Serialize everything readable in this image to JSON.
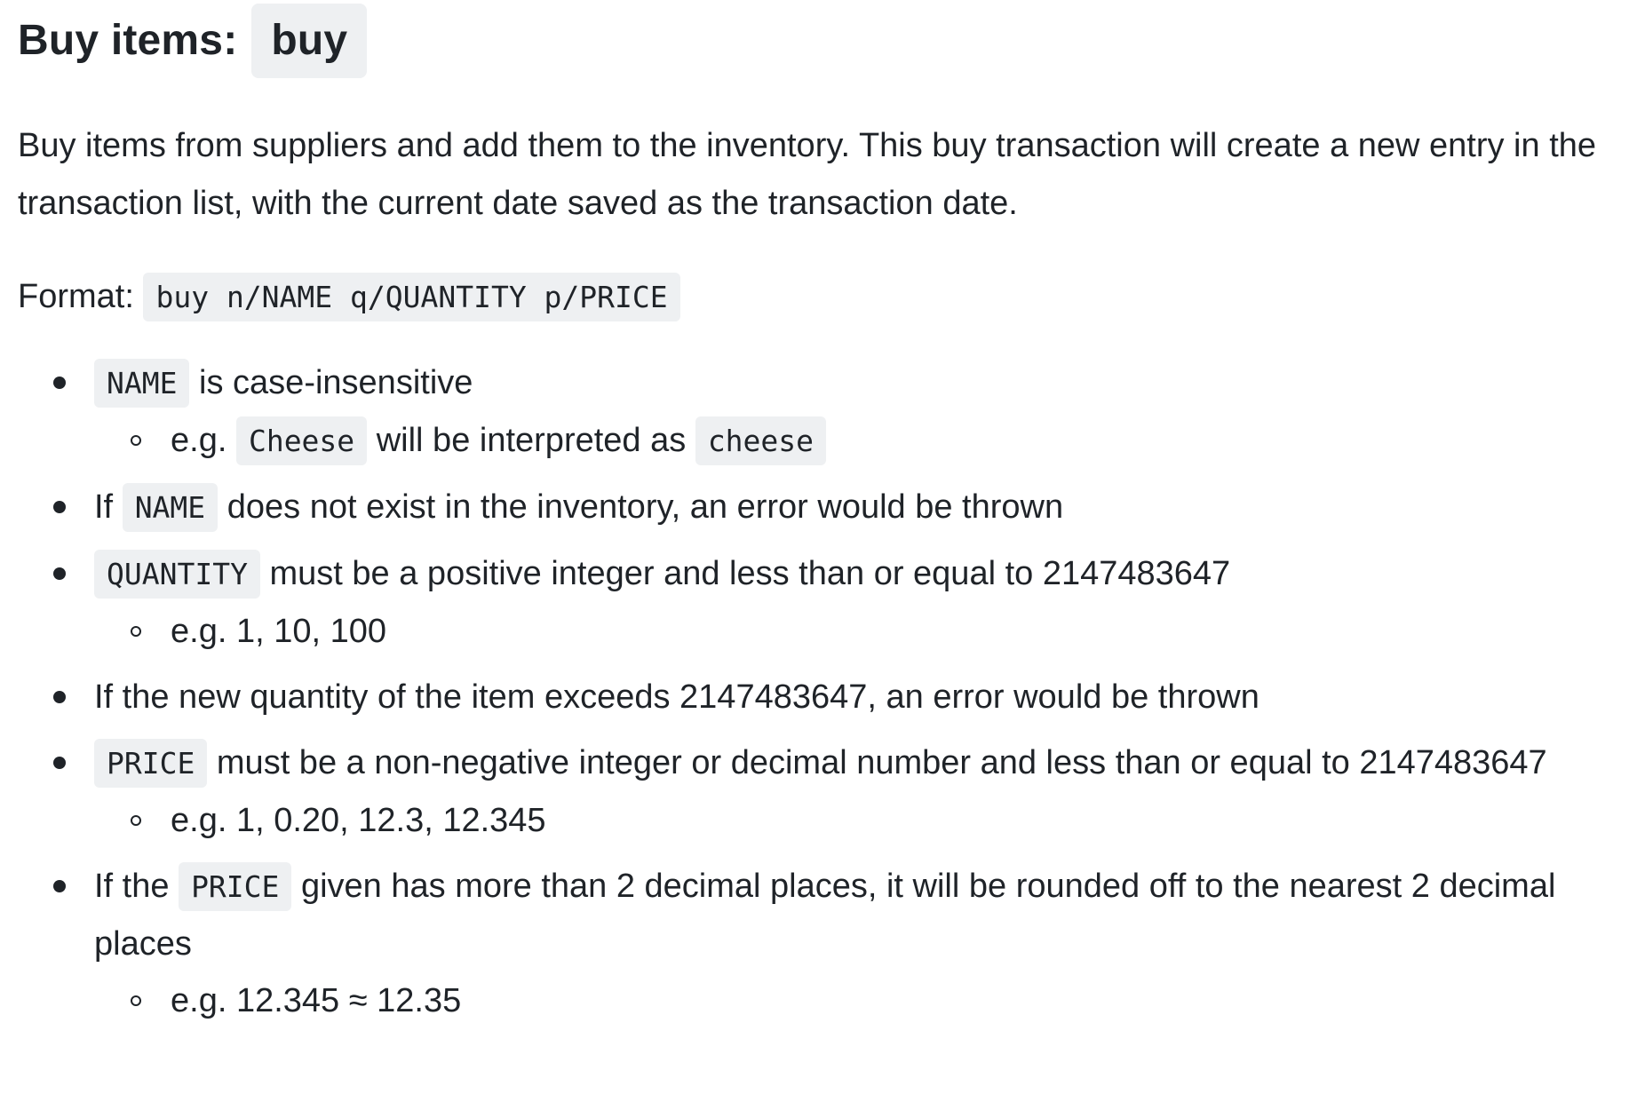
{
  "heading": {
    "text": "Buy items:",
    "command": "buy"
  },
  "description": "Buy items from suppliers and add them to the inventory. This buy transaction will create a new entry in the transaction list, with the current date saved as the transaction date.",
  "format": {
    "label": "Format:",
    "code": "buy n/NAME q/QUANTITY p/PRICE"
  },
  "rules": {
    "r1": {
      "code": "NAME",
      "text": "is case-insensitive",
      "sub": {
        "prefix": "e.g.",
        "code1": "Cheese",
        "middle": "will be interpreted as",
        "code2": "cheese"
      }
    },
    "r2": {
      "prefix": "If",
      "code": "NAME",
      "text": "does not exist in the inventory, an error would be thrown"
    },
    "r3": {
      "code": "QUANTITY",
      "text": "must be a positive integer and less than or equal to 2147483647",
      "sub": "e.g. 1, 10, 100"
    },
    "r4": {
      "text": "If the new quantity of the item exceeds 2147483647, an error would be thrown"
    },
    "r5": {
      "code": "PRICE",
      "text": "must be a non-negative integer or decimal number and less than or equal to 2147483647",
      "sub": "e.g. 1, 0.20, 12.3, 12.345"
    },
    "r6": {
      "prefix": "If the",
      "code": "PRICE",
      "text": "given has more than 2 decimal places, it will be rounded off to the nearest 2 decimal places",
      "sub": "e.g. 12.345 ≈ 12.35"
    }
  }
}
